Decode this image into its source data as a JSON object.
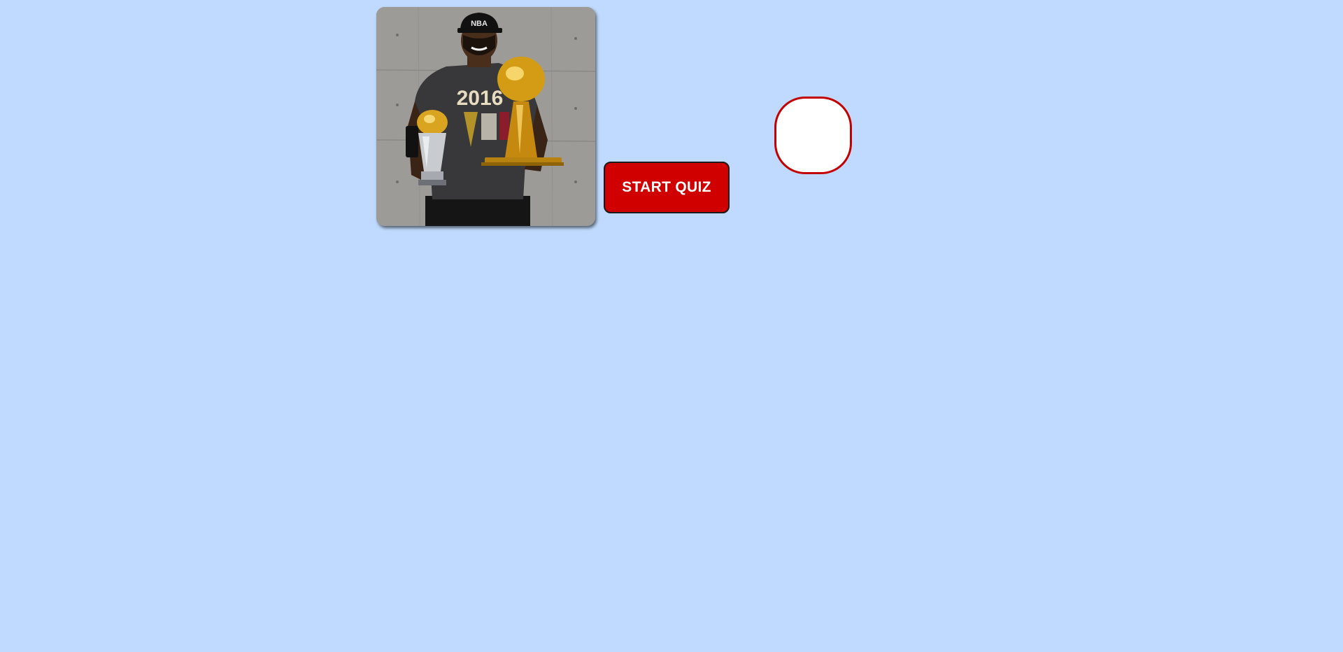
{
  "quiz": {
    "start_label": "START QUIZ",
    "timer_value": ""
  },
  "photo": {
    "subject": "basketball player holding two championship trophies",
    "shirt_text": "2016",
    "cap_text": "NBA"
  },
  "colors": {
    "background": "#bfdafe",
    "button_fill": "#d00000",
    "circle_border": "#c30000",
    "circle_fill": "#ffffff"
  }
}
